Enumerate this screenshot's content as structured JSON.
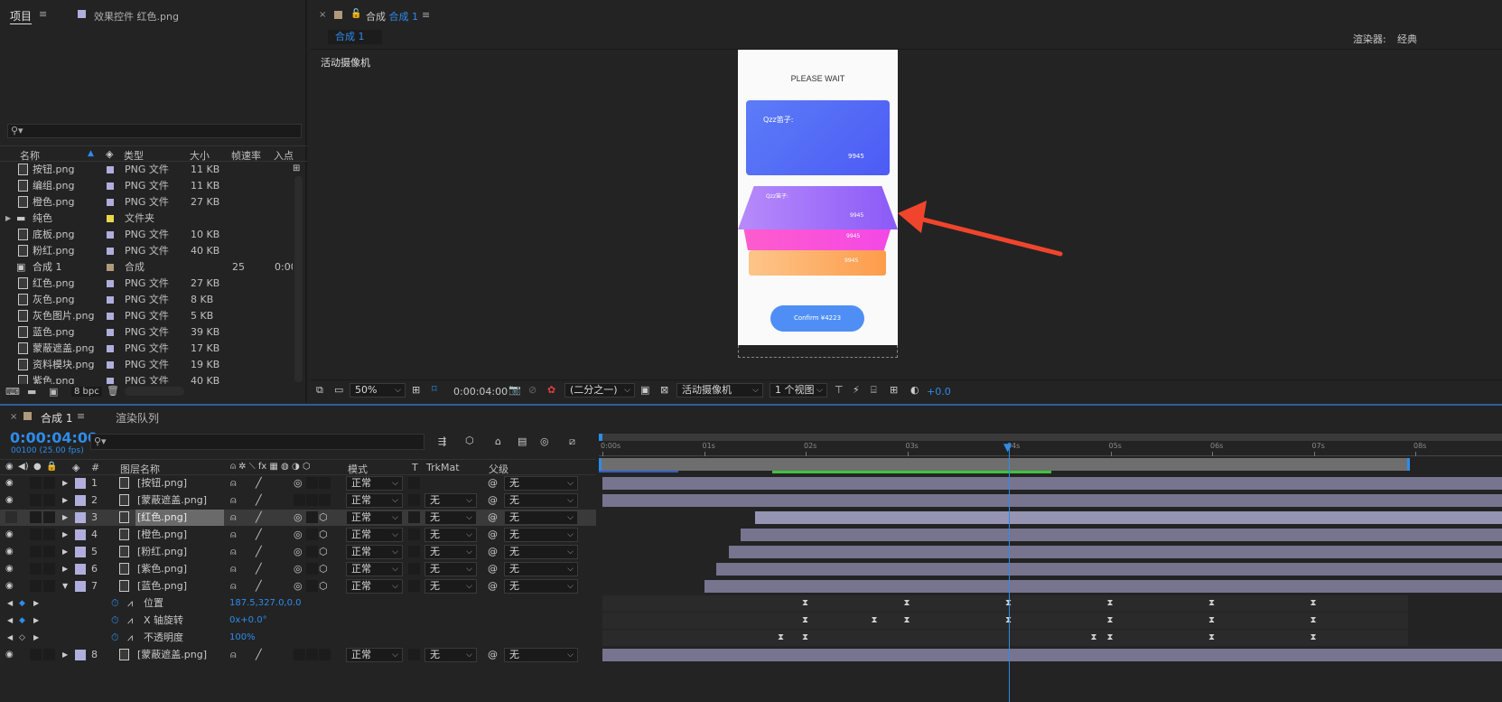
{
  "project_panel": {
    "tab": "项目",
    "tab2": "效果控件 红色.png",
    "search_placeholder": "",
    "columns": {
      "name": "名称",
      "type": "类型",
      "size": "大小",
      "fps": "帧速率",
      "in": "入点"
    },
    "items": [
      {
        "name": "按钮.png",
        "type": "PNG 文件",
        "size": "11 KB",
        "color": "#b0aedc",
        "kind": "file"
      },
      {
        "name": "编组.png",
        "type": "PNG 文件",
        "size": "11 KB",
        "color": "#b0aedc",
        "kind": "file"
      },
      {
        "name": "橙色.png",
        "type": "PNG 文件",
        "size": "27 KB",
        "color": "#b0aedc",
        "kind": "file"
      },
      {
        "name": "纯色",
        "type": "文件夹",
        "size": "",
        "color": "#e8d84a",
        "kind": "folder"
      },
      {
        "name": "底板.png",
        "type": "PNG 文件",
        "size": "10 KB",
        "color": "#b0aedc",
        "kind": "file"
      },
      {
        "name": "粉红.png",
        "type": "PNG 文件",
        "size": "40 KB",
        "color": "#b0aedc",
        "kind": "file"
      },
      {
        "name": "合成 1",
        "type": "合成",
        "size": "",
        "fps": "25",
        "in": "0:00:",
        "color": "#b09a7c",
        "kind": "comp"
      },
      {
        "name": "红色.png",
        "type": "PNG 文件",
        "size": "27 KB",
        "color": "#b0aedc",
        "kind": "file"
      },
      {
        "name": "灰色.png",
        "type": "PNG 文件",
        "size": "8 KB",
        "color": "#b0aedc",
        "kind": "file"
      },
      {
        "name": "灰色图片.png",
        "type": "PNG 文件",
        "size": "5 KB",
        "color": "#b0aedc",
        "kind": "file"
      },
      {
        "name": "蓝色.png",
        "type": "PNG 文件",
        "size": "39 KB",
        "color": "#b0aedc",
        "kind": "file"
      },
      {
        "name": "蒙蔽遮盖.png",
        "type": "PNG 文件",
        "size": "17 KB",
        "color": "#b0aedc",
        "kind": "file"
      },
      {
        "name": "资料模块.png",
        "type": "PNG 文件",
        "size": "19 KB",
        "color": "#b0aedc",
        "kind": "file"
      },
      {
        "name": "紫色.png",
        "type": "PNG 文件",
        "size": "40 KB",
        "color": "#b0aedc",
        "kind": "file"
      }
    ],
    "bpc": "8 bpc"
  },
  "composition_panel": {
    "title_prefix": "合成",
    "title_name": "合成 1",
    "tab": "合成 1",
    "renderer_label": "渲染器:",
    "renderer_value": "经典",
    "camera_label": "活动摄像机",
    "footer": {
      "zoom": "50%",
      "timecode": "0:00:04:00",
      "resolution": "(二分之一)",
      "camera": "活动摄像机",
      "views": "1 个视图",
      "exposure": "+0.0"
    }
  },
  "phone": {
    "heading": "PLEASE WAIT",
    "card_owner": "Qzz笛子:",
    "card_number": "9945",
    "card2_owner": "Qzz笛子:",
    "card2_number": "9945",
    "card3_number": "9945",
    "card4_number": "9945",
    "button": "Confirm ¥4223"
  },
  "timeline": {
    "tab": "合成 1",
    "tab2": "渲染队列",
    "timecode": "0:00:04:00",
    "frames": "00100 (25.00 fps)",
    "ruler": [
      "0:00s",
      "01s",
      "02s",
      "03s",
      "04s",
      "05s",
      "06s",
      "07s",
      "08s"
    ],
    "playhead_fraction": 0.5,
    "headers": {
      "num": "#",
      "layer_name": "图层名称",
      "mode": "模式",
      "t": "T",
      "trkmat": "TrkMat",
      "parent": "父级"
    },
    "layers": [
      {
        "num": "1",
        "name": "[按钮.png]",
        "mode": "正常",
        "trkmat": "",
        "parent": "无",
        "start_s": 0
      },
      {
        "num": "2",
        "name": "[蒙蔽遮盖.png]",
        "mode": "正常",
        "trkmat": "无",
        "parent": "无",
        "start_s": 0
      },
      {
        "num": "3",
        "name": "[红色.png]",
        "mode": "正常",
        "trkmat": "无",
        "parent": "无",
        "start_s": 1.5
      },
      {
        "num": "4",
        "name": "[橙色.png]",
        "mode": "正常",
        "trkmat": "无",
        "parent": "无",
        "start_s": 1.36
      },
      {
        "num": "5",
        "name": "[粉红.png]",
        "mode": "正常",
        "trkmat": "无",
        "parent": "无",
        "start_s": 1.24
      },
      {
        "num": "6",
        "name": "[紫色.png]",
        "mode": "正常",
        "trkmat": "无",
        "parent": "无",
        "start_s": 1.12
      },
      {
        "num": "7",
        "name": "[蓝色.png]",
        "mode": "正常",
        "trkmat": "无",
        "parent": "无",
        "start_s": 1.0
      }
    ],
    "properties": [
      {
        "name": "位置",
        "value": "187.5,327.0,0.0",
        "keys_s": [
          2,
          3,
          4,
          5,
          6,
          7
        ]
      },
      {
        "name": "X 轴旋转",
        "value": "0x+0.0°",
        "keys_s": [
          2,
          2.68,
          3,
          4,
          5,
          6,
          7
        ]
      },
      {
        "name": "不透明度",
        "value": "100%",
        "keys_s": [
          1.76,
          2,
          4.84,
          5,
          6,
          7
        ]
      }
    ],
    "layer8": {
      "num": "8",
      "name": "[蒙蔽遮盖.png]",
      "mode": "正常",
      "trkmat": "无",
      "parent": "无"
    }
  }
}
